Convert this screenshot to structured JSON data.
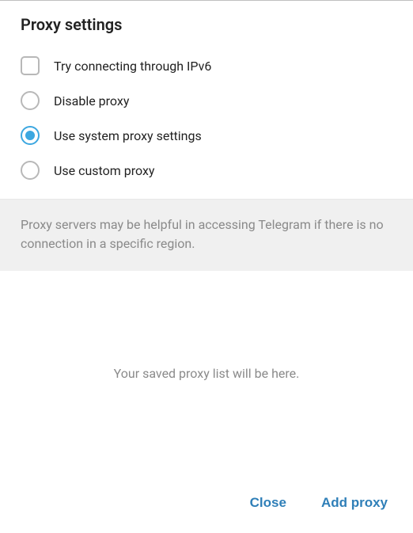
{
  "header": {
    "title": "Proxy settings"
  },
  "options": {
    "ipv6": {
      "label": "Try connecting through IPv6",
      "checked": false
    },
    "proxyMode": {
      "selected": "system",
      "disable": {
        "label": "Disable proxy"
      },
      "system": {
        "label": "Use system proxy settings"
      },
      "custom": {
        "label": "Use custom proxy"
      }
    }
  },
  "hint": "Proxy servers may be helpful in accessing Telegram if there is no connection in a specific region.",
  "emptyList": "Your saved proxy list will be here.",
  "footer": {
    "close": "Close",
    "addProxy": "Add proxy"
  },
  "colors": {
    "accent": "#3ca7e0",
    "link": "#2f7fb8"
  }
}
